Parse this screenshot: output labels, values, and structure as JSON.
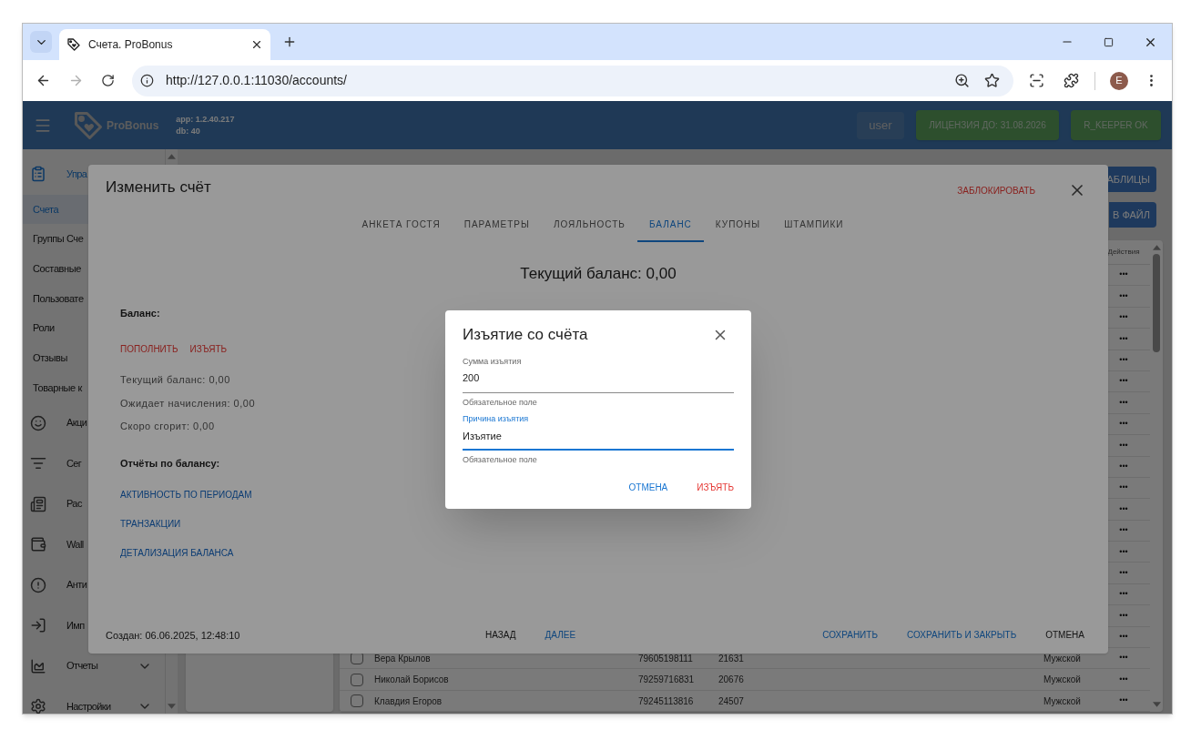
{
  "browser": {
    "tab_title": "Счета. ProBonus",
    "url": "http://127.0.0.1:11030/accounts/",
    "profile_initial": "E"
  },
  "header": {
    "brand": "ProBonus",
    "app_version": "app: 1.2.40.217",
    "db_version": "db: 40",
    "user": "user",
    "license": "ЛИЦЕНЗИЯ ДО: 31.08.2026",
    "status": "R_KEEPER OK"
  },
  "sidebar": {
    "items": [
      {
        "kind": "group",
        "label": "Упра",
        "selected": true
      },
      {
        "kind": "item",
        "label": "Счета",
        "selected": true
      },
      {
        "kind": "item",
        "label": "Группы Сче",
        "selected": false
      },
      {
        "kind": "item",
        "label": "Составные",
        "selected": false
      },
      {
        "kind": "item",
        "label": "Пользовате",
        "selected": false
      },
      {
        "kind": "item",
        "label": "Роли",
        "selected": false
      },
      {
        "kind": "item",
        "label": "Отзывы",
        "selected": false
      },
      {
        "kind": "item",
        "label": "Товарные к",
        "selected": false
      },
      {
        "kind": "group",
        "label": "Акци",
        "selected": false
      },
      {
        "kind": "group",
        "label": "Сег",
        "selected": false
      },
      {
        "kind": "group",
        "label": "Рас",
        "selected": false
      },
      {
        "kind": "group",
        "label": "Wall",
        "selected": false
      },
      {
        "kind": "group",
        "label": "Анти",
        "selected": false
      },
      {
        "kind": "group",
        "label": "Имп",
        "selected": false
      },
      {
        "kind": "group",
        "label": "Отчеты",
        "selected": false,
        "has_submenu": true
      },
      {
        "kind": "group",
        "label": "Настройки",
        "selected": false,
        "has_submenu": true
      }
    ]
  },
  "toolbar": {
    "buttons": [
      "АБЛИЦЫ",
      "В ФАЙЛ"
    ]
  },
  "table": {
    "actions_header": "Действия",
    "rows": [
      {
        "actions": "•••"
      },
      {
        "actions": "•••"
      },
      {
        "actions": "•••"
      },
      {
        "actions": "•••"
      },
      {
        "actions": "•••"
      },
      {
        "actions": "•••"
      },
      {
        "actions": "•••"
      },
      {
        "actions": "•••"
      },
      {
        "actions": "•••"
      },
      {
        "actions": "•••"
      },
      {
        "actions": "•••"
      },
      {
        "actions": "•••"
      },
      {
        "actions": "•••"
      },
      {
        "actions": "•••"
      },
      {
        "actions": "•••"
      },
      {
        "actions": "•••"
      },
      {
        "actions": "•••"
      },
      {
        "actions": "•••"
      },
      {
        "checked": false,
        "name": "Вера Крылов",
        "phone": "79605198111",
        "card": "21631",
        "gender": "Мужской",
        "actions": "•••"
      },
      {
        "checked": false,
        "name": "Николай Борисов",
        "phone": "79259716831",
        "card": "20676",
        "gender": "Мужской",
        "actions": "•••"
      },
      {
        "checked": false,
        "name": "Клавдия Егоров",
        "phone": "79245113816",
        "card": "24507",
        "gender": "Мужской",
        "actions": "•••"
      }
    ]
  },
  "edit_dialog": {
    "title": "Изменить счёт",
    "block_action": "ЗАБЛОКИРОВАТЬ",
    "tabs": [
      {
        "label": "АНКЕТА ГОСТЯ",
        "selected": false
      },
      {
        "label": "ПАРАМЕТРЫ",
        "selected": false
      },
      {
        "label": "ЛОЯЛЬНОСТЬ",
        "selected": false
      },
      {
        "label": "БАЛАНС",
        "selected": true
      },
      {
        "label": "КУПОНЫ",
        "selected": false
      },
      {
        "label": "ШТАМПИКИ",
        "selected": false
      }
    ],
    "current_balance": "Текущий баланс: 0,00",
    "balance_heading": "Баланс:",
    "balance_actions": [
      "ПОПОЛНИТЬ",
      "ИЗЪЯТЬ"
    ],
    "balance_lines": [
      "Текущий баланс: 0,00",
      "Ожидает начисления: 0,00",
      "Скоро сгорит: 0,00"
    ],
    "reports_heading": "Отчёты по балансу:",
    "report_links": [
      "АКТИВНОСТЬ ПО ПЕРИОДАМ",
      "ТРАНЗАКЦИИ",
      "ДЕТАЛИЗАЦИЯ БАЛАНСА"
    ],
    "created": "Создан: 06.06.2025, 12:48:10",
    "nav_buttons": [
      {
        "label": "НАЗАД",
        "kind": "default"
      },
      {
        "label": "ДАЛЕЕ",
        "kind": "primary"
      }
    ],
    "footer_buttons": [
      {
        "label": "СОХРАНИТЬ",
        "kind": "primary"
      },
      {
        "label": "СОХРАНИТЬ И ЗАКРЫТЬ",
        "kind": "primary"
      },
      {
        "label": "ОТМЕНА",
        "kind": "default"
      }
    ]
  },
  "withdraw_dialog": {
    "title": "Изъятие со счёта",
    "fields": [
      {
        "label": "Сумма изъятия",
        "value": "200",
        "helper": "Обязательное поле",
        "focused": false
      },
      {
        "label": "Причина изъятия",
        "value": "Изъятие",
        "helper": "Обязательное поле",
        "focused": true
      }
    ],
    "buttons": [
      {
        "label": "ОТМЕНА",
        "kind": "primary"
      },
      {
        "label": "ИЗЪЯТЬ",
        "kind": "danger"
      }
    ]
  }
}
